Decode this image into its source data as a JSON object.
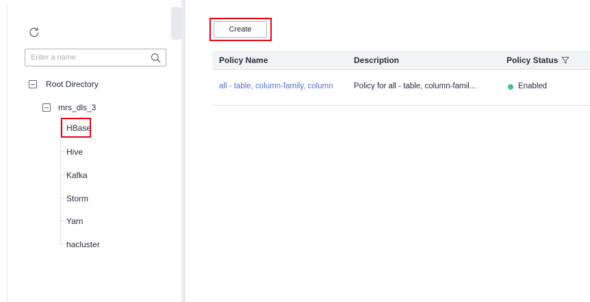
{
  "sidebar": {
    "refresh_icon": "refresh-icon",
    "search": {
      "placeholder": "Enter a name.",
      "value": ""
    },
    "tree": {
      "root_label": "Root Directory",
      "cluster_label": "mrs_dls_3",
      "services": [
        "HBase",
        "Hive",
        "Kafka",
        "Storm",
        "Yarn",
        "hacluster"
      ],
      "selected": "HBase"
    }
  },
  "toolbar": {
    "create_label": "Create"
  },
  "table": {
    "columns": [
      "Policy Name",
      "Description",
      "Policy Status"
    ],
    "rows": [
      {
        "name": "all - table, column-family, column",
        "description": "Policy for all - table, column-famil...",
        "status": "Enabled"
      }
    ]
  },
  "colors": {
    "highlight": "#e60012",
    "link": "#526ecc",
    "status_enabled": "#3ac295",
    "header_bg": "#f2f3f5"
  }
}
